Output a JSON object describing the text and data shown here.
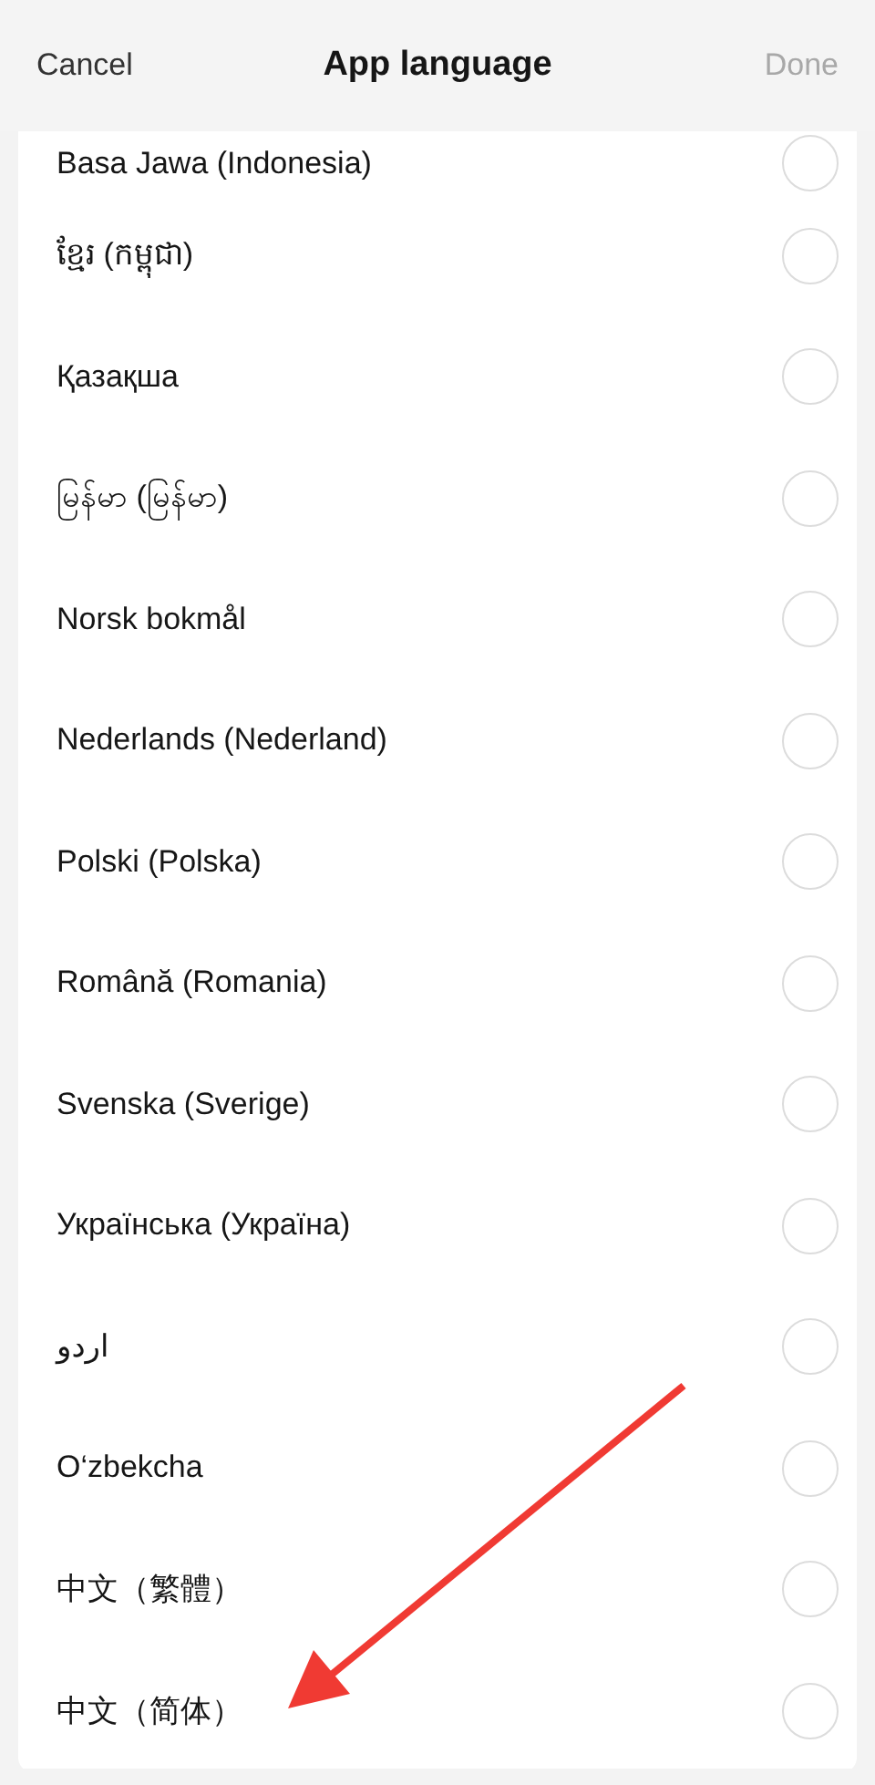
{
  "header": {
    "cancel": "Cancel",
    "title": "App language",
    "done": {
      "label": "Done",
      "disabled": true
    }
  },
  "languages": [
    {
      "name": "Basa Jawa (Indonesia)",
      "selected": false
    },
    {
      "name": "ខ្មែរ (កម្ពុជា)",
      "selected": false
    },
    {
      "name": "Қазақша",
      "selected": false
    },
    {
      "name": "မြန်မာ (မြန်မာ)",
      "selected": false
    },
    {
      "name": "Norsk bokmål",
      "selected": false
    },
    {
      "name": "Nederlands (Nederland)",
      "selected": false
    },
    {
      "name": "Polski (Polska)",
      "selected": false
    },
    {
      "name": "Română (Romania)",
      "selected": false
    },
    {
      "name": "Svenska (Sverige)",
      "selected": false
    },
    {
      "name": "Українська (Україна)",
      "selected": false
    },
    {
      "name": "اردو",
      "selected": false
    },
    {
      "name": "O‘zbekcha",
      "selected": false
    },
    {
      "name": "中文（繁體）",
      "selected": false
    },
    {
      "name": "中文（简体）",
      "selected": false
    }
  ]
}
